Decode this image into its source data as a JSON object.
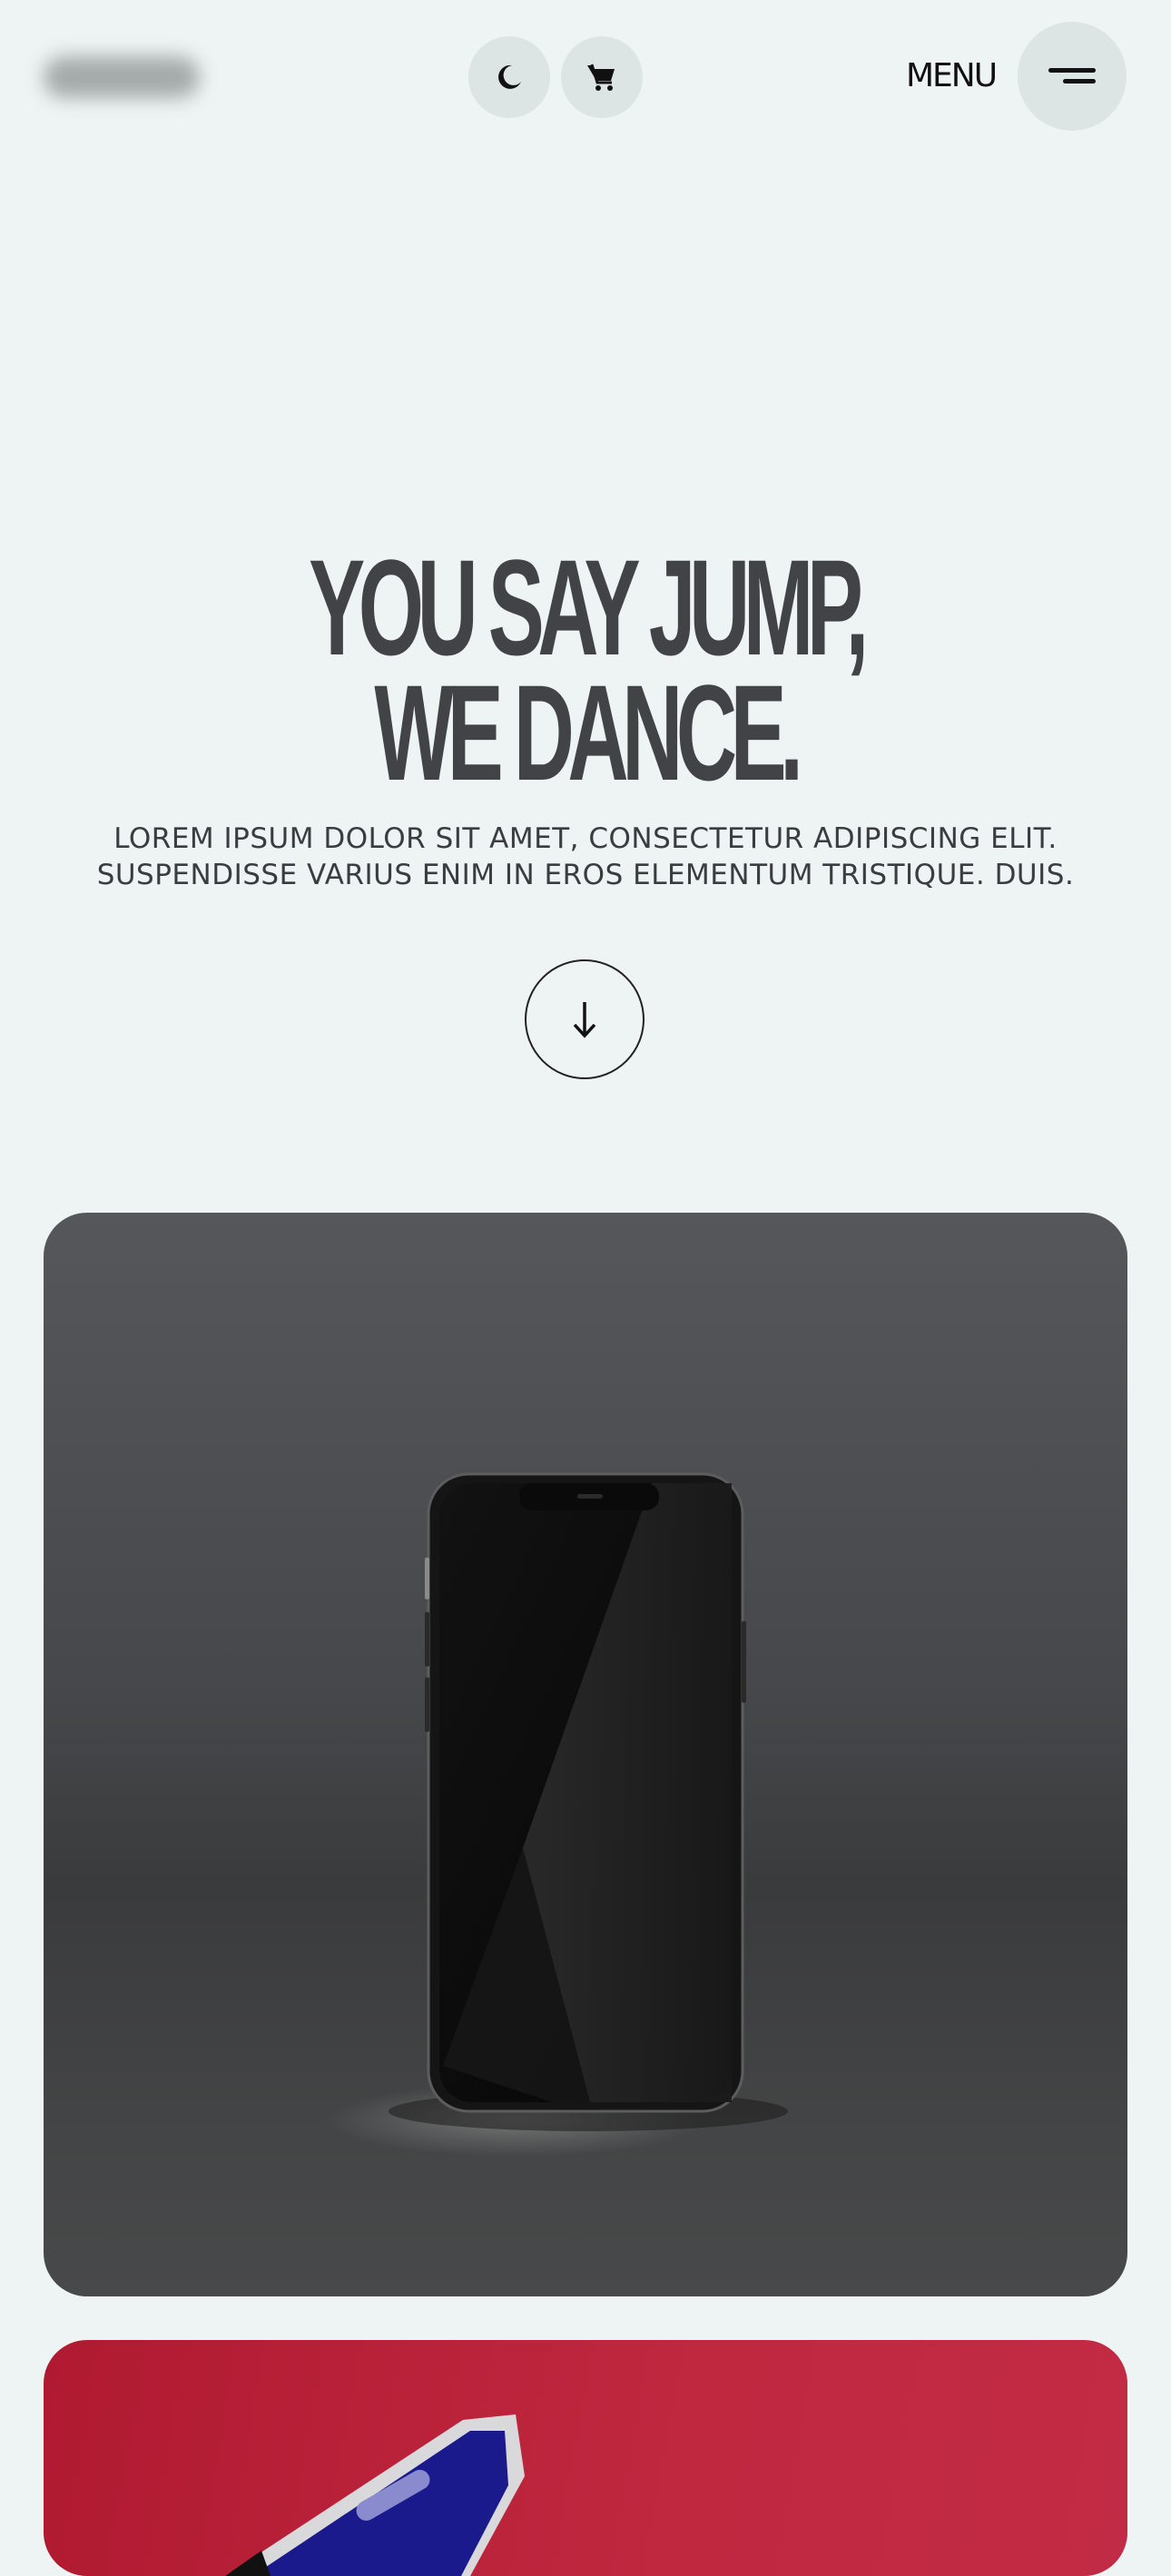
{
  "header": {
    "logo_icon": "blurred-logo",
    "theme_toggle_icon": "moon-icon",
    "cart_icon": "cart-icon",
    "menu_label": "MENU",
    "menu_icon": "hamburger-icon"
  },
  "hero": {
    "headline_line1": "YOU SAY JUMP,",
    "headline_line2": "WE DANCE.",
    "subtitle_line1": "LOREM IPSUM DOLOR SIT AMET, CONSECTETUR ADIPISCING ELIT.",
    "subtitle_line2": "SUSPENDISSE VARIUS ENIM IN EROS ELEMENTUM TRISTIQUE. DUIS.",
    "scroll_icon": "arrow-down-icon"
  },
  "cards": [
    {
      "image": "black-smartphone-photo",
      "background": "#4a4b4e"
    },
    {
      "image": "phone-on-red-photo",
      "background": "#c02840"
    }
  ],
  "colors": {
    "page_background": "#eef3f3",
    "headline": "#424346",
    "button_background": "#dde4e4"
  }
}
